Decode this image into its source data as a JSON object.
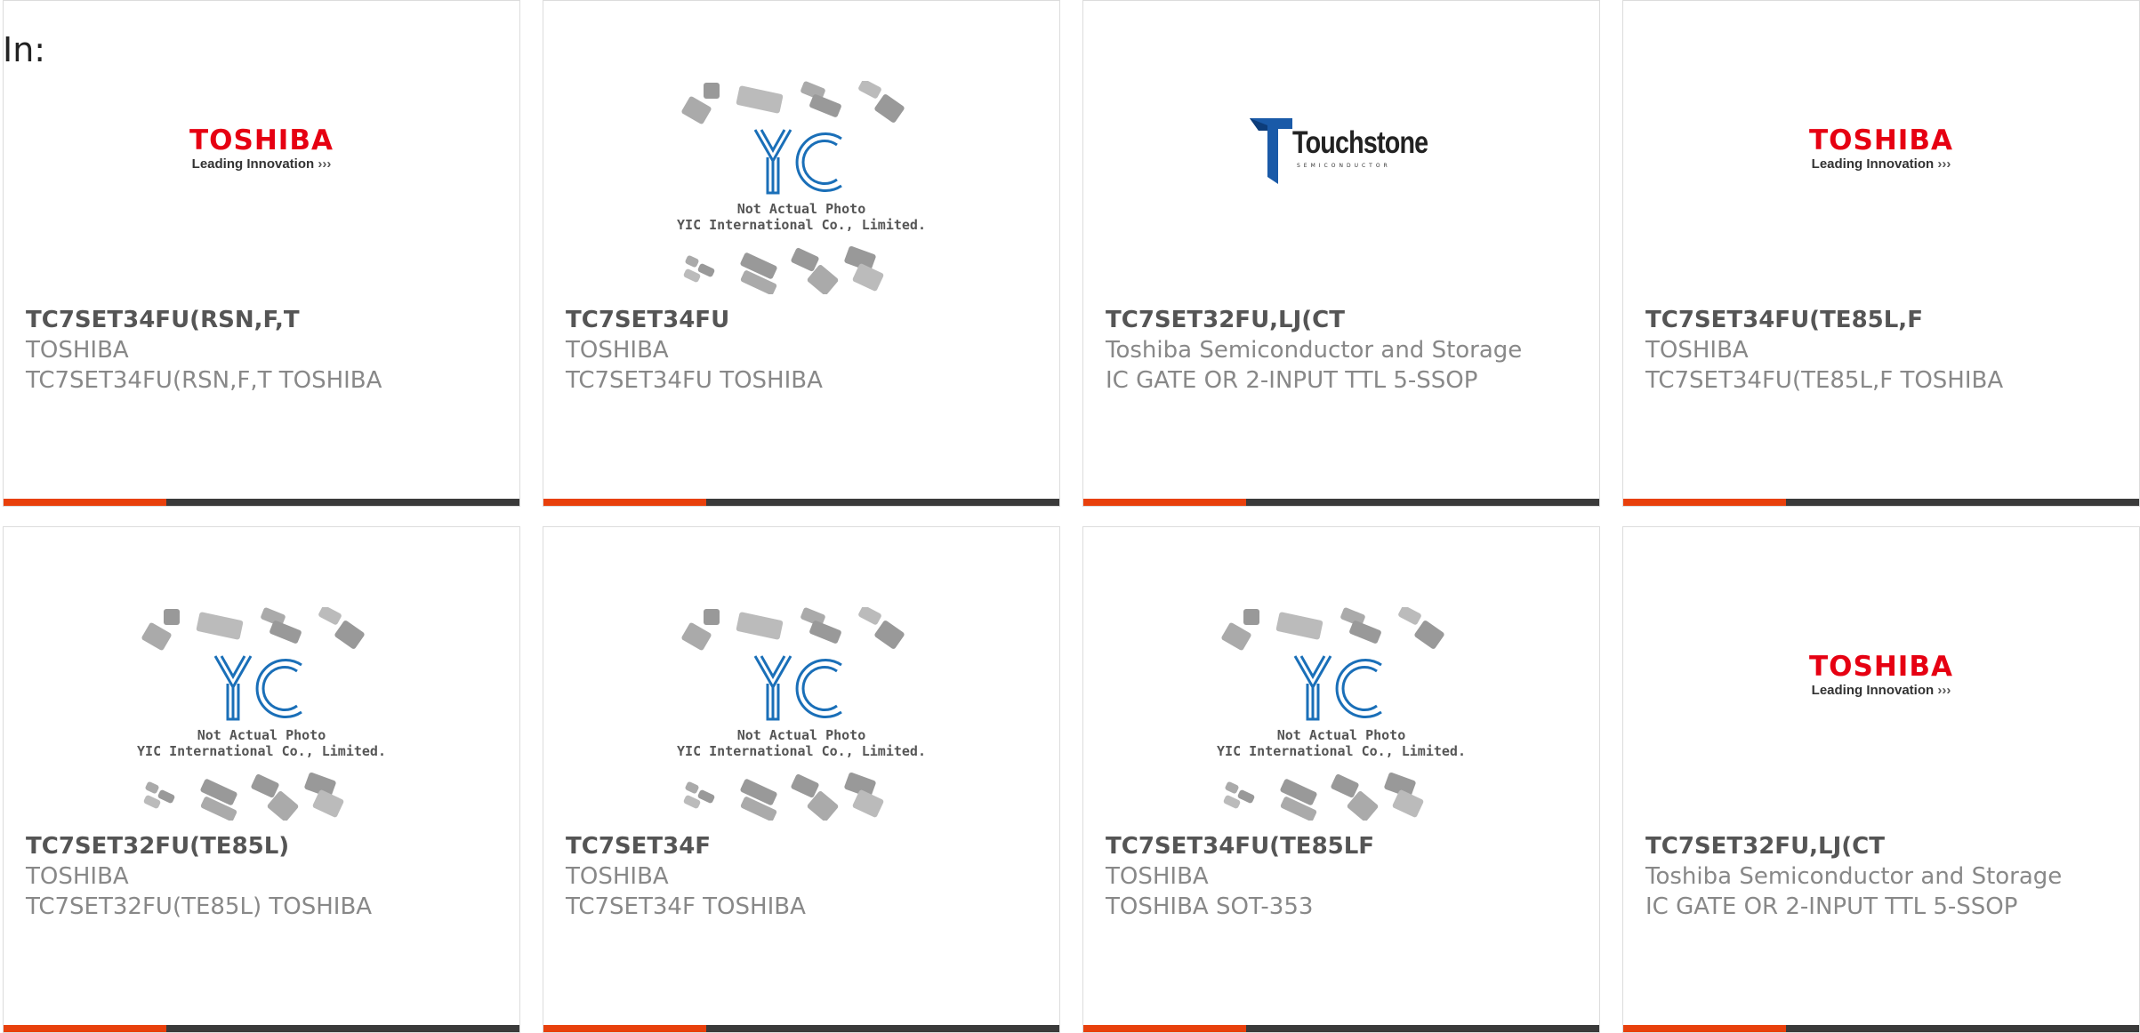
{
  "header": {
    "in_label": "In:"
  },
  "logos": {
    "toshiba": {
      "brand": "TOSHIBA",
      "slogan": "Leading Innovation",
      "chevrons": "›››",
      "color": "#e60012"
    },
    "yic": {
      "line1": "Not Actual Photo",
      "line2": "YIC International Co., Limited."
    },
    "touchstone": {
      "word": "Touchstone",
      "sub": "SEMICONDUCTOR"
    }
  },
  "colors": {
    "accent": "#e8400c",
    "bar": "#3a3a3a",
    "border": "#dcdcdc"
  },
  "products": [
    {
      "logo": "toshiba",
      "title": "TC7SET34FU(RSN,F,T",
      "maker": "TOSHIBA",
      "desc": "TC7SET34FU(RSN,F,T TOSHIBA"
    },
    {
      "logo": "yic",
      "title": "TC7SET34FU",
      "maker": "TOSHIBA",
      "desc": "TC7SET34FU TOSHIBA"
    },
    {
      "logo": "touchstone",
      "title": "TC7SET32FU,LJ(CT",
      "maker": "Toshiba Semiconductor and Storage",
      "desc": "IC GATE OR 2-INPUT TTL 5-SSOP"
    },
    {
      "logo": "toshiba",
      "title": "TC7SET34FU(TE85L,F",
      "maker": "TOSHIBA",
      "desc": "TC7SET34FU(TE85L,F TOSHIBA"
    },
    {
      "logo": "yic",
      "title": "TC7SET32FU(TE85L)",
      "maker": "TOSHIBA",
      "desc": "TC7SET32FU(TE85L) TOSHIBA"
    },
    {
      "logo": "yic",
      "title": "TC7SET34F",
      "maker": "TOSHIBA",
      "desc": "TC7SET34F TOSHIBA"
    },
    {
      "logo": "yic",
      "title": "TC7SET34FU(TE85LF",
      "maker": "TOSHIBA",
      "desc": "TOSHIBA SOT-353"
    },
    {
      "logo": "toshiba",
      "title": "TC7SET32FU,LJ(CT",
      "maker": "Toshiba Semiconductor and Storage",
      "desc": "IC GATE OR 2-INPUT TTL 5-SSOP"
    }
  ]
}
